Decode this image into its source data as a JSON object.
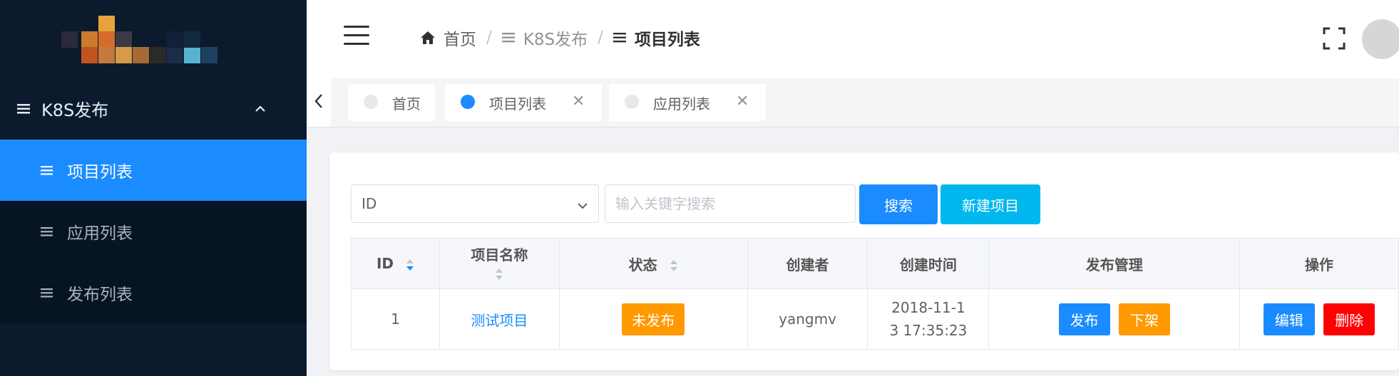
{
  "sidebar": {
    "menu_title": "K8S发布",
    "items": [
      {
        "label": "项目列表",
        "active": true
      },
      {
        "label": "应用列表",
        "active": false
      },
      {
        "label": "发布列表",
        "active": false
      }
    ]
  },
  "header": {
    "breadcrumb": [
      {
        "label": "首页",
        "icon": "home-icon"
      },
      {
        "label": "K8S发布",
        "icon": "list-icon"
      },
      {
        "label": "项目列表",
        "icon": "list-icon"
      }
    ]
  },
  "tags": [
    {
      "label": "首页",
      "active": false,
      "closable": false
    },
    {
      "label": "项目列表",
      "active": true,
      "closable": true
    },
    {
      "label": "应用列表",
      "active": false,
      "closable": true
    }
  ],
  "filter": {
    "select_value": "ID",
    "search_placeholder": "输入关键字搜索",
    "search_button": "搜索",
    "new_button": "新建项目"
  },
  "table": {
    "headers": [
      "ID",
      "项目名称",
      "状态",
      "创建者",
      "创建时间",
      "发布管理",
      "操作"
    ],
    "rows": [
      {
        "id": "1",
        "name": "测试项目",
        "status": "未发布",
        "creator": "yangmv",
        "created_line1": "2018-11-1",
        "created_line2": "3 17:35:23",
        "publish_label": "发布",
        "unpublish_label": "下架",
        "edit_label": "编辑",
        "delete_label": "删除"
      }
    ]
  },
  "colors": {
    "primary": "#1a8cff",
    "cyan": "#00b7ee",
    "warning": "#ff9900",
    "danger": "#ff0000",
    "sidebar_bg": "#0b1b2d"
  }
}
